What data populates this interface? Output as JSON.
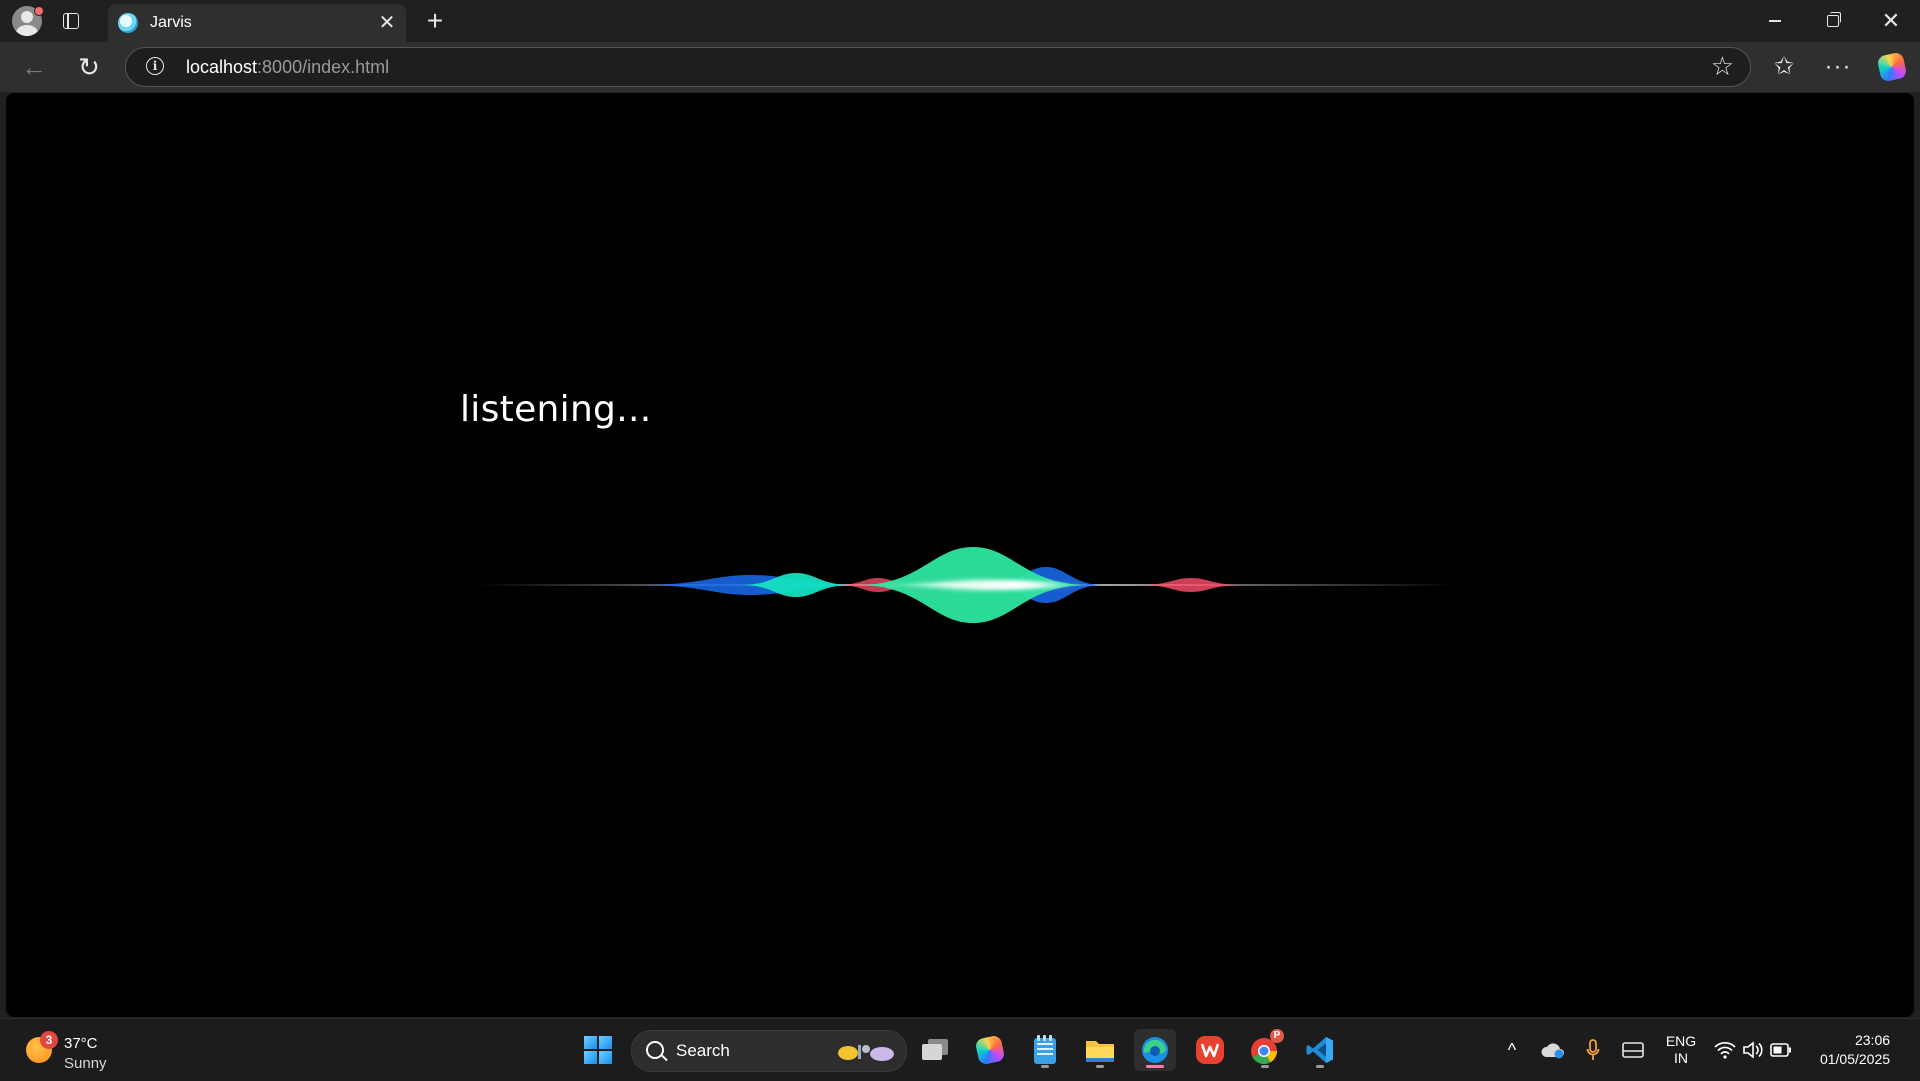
{
  "browser": {
    "tab": {
      "title": "Jarvis",
      "close_glyph": "✕"
    },
    "new_tab_glyph": "+",
    "window_controls": {
      "close_glyph": "✕"
    },
    "toolbar": {
      "back_glyph": "←",
      "refresh_glyph": "↻",
      "info_glyph": "i",
      "url_host": "localhost",
      "url_rest": ":8000/index.html",
      "favorite_glyph": "☆",
      "favorites_glyph": "✩",
      "more_glyph": "···"
    }
  },
  "page": {
    "status_text": "listening...",
    "wave_colors": [
      "#14e0c0",
      "#1a6cf0",
      "#ff4f6d",
      "#2ee6a0",
      "#ffffff"
    ]
  },
  "taskbar": {
    "weather": {
      "badge": "3",
      "temperature": "37°C",
      "condition": "Sunny"
    },
    "search": {
      "label": "Search"
    },
    "pinned_apps": [
      "start-icon",
      "search-icon",
      "task-view-icon",
      "copilot-icon",
      "notepad-icon",
      "file-explorer-icon",
      "edge-icon",
      "wps-office-icon",
      "chrome-icon",
      "vscode-icon"
    ],
    "chrome_badge": "P",
    "tray": {
      "overflow_glyph": "^",
      "language_line1": "ENG",
      "language_line2": "IN",
      "time": "23:06",
      "date": "01/05/2025"
    }
  }
}
